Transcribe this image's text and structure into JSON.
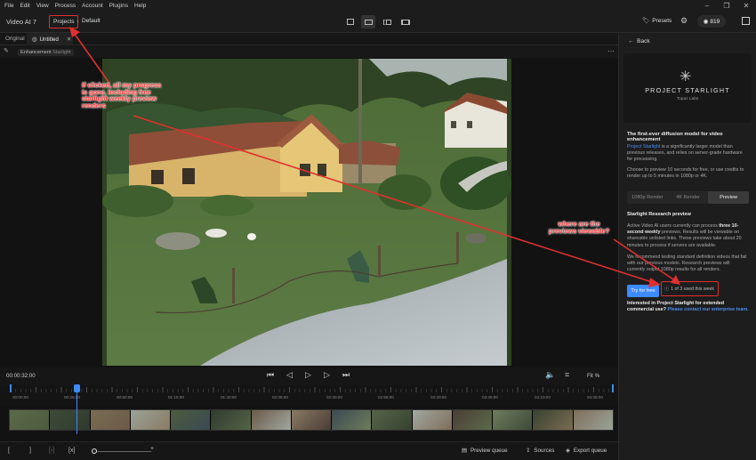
{
  "menu": [
    "File",
    "Edit",
    "View",
    "Process",
    "Account",
    "Plugins",
    "Help"
  ],
  "window_controls": [
    "–",
    "❐",
    "✕"
  ],
  "header": {
    "app_title": "Video AI 7",
    "projects_label": "Projects",
    "crumb": "Default",
    "presets_label": "Presets",
    "credits": "819"
  },
  "tabs": {
    "original": "Original",
    "untitled": "Untitled"
  },
  "enhancement": {
    "label": "Enhancement",
    "model": "Starlight"
  },
  "transport": {
    "timecode": "00:00:32:00",
    "fit": "Fit %",
    "ticks": [
      "00:00:00",
      "00:25:00",
      "00:50:00",
      "01:15:00",
      "01:40:00",
      "02:05:00",
      "02:30:00",
      "02:55:00",
      "03:20:00",
      "03:45:00",
      "04:10:00",
      "04:35:00"
    ]
  },
  "bottombar": {
    "preview_queue": "Preview queue",
    "sources": "Sources",
    "export_queue": "Export queue"
  },
  "panel": {
    "back": "Back",
    "product_title": "PROJECT STARLIGHT",
    "product_sub": "Topaz Labs",
    "heading": "The first-ever diffusion model for video enhancement",
    "intro_link": "Project Starlight",
    "intro_rest": " is a significantly larger model than previous releases, and relies on server-grade hardware for processing.",
    "choose": "Choose to preview 10 seconds for free, or use credits to render up to 5 minutes in 1080p or 4K.",
    "seg": [
      "1080p Render",
      "4K Render",
      "Preview"
    ],
    "research_heading": "Starlight Research preview",
    "research_p1_a": "Active Video AI users currently can process ",
    "research_p1_b": "three 10-second weekly",
    "research_p1_c": " previews. Results will be viewable on shareable unlisted links. These previews take about 20 minutes to process if servers are available.",
    "research_p2": "We recommend testing standard definition videos that fail with our previous models. Research previews will currently output 1080p results for all renders.",
    "try_label": "Try for free",
    "usage": "1 of 3 used this week",
    "interested_a": "Interested in Project Starlight for extended commercial use? ",
    "interested_b": "Please contact our enterprise team."
  },
  "annotations": {
    "note1": "if clicked, all my progress is gone, including free starlight weekly preview renders",
    "note2": "where are the previews viewable?"
  },
  "colors": {
    "accent": "#3d8bff",
    "annotation": "#e03030"
  }
}
